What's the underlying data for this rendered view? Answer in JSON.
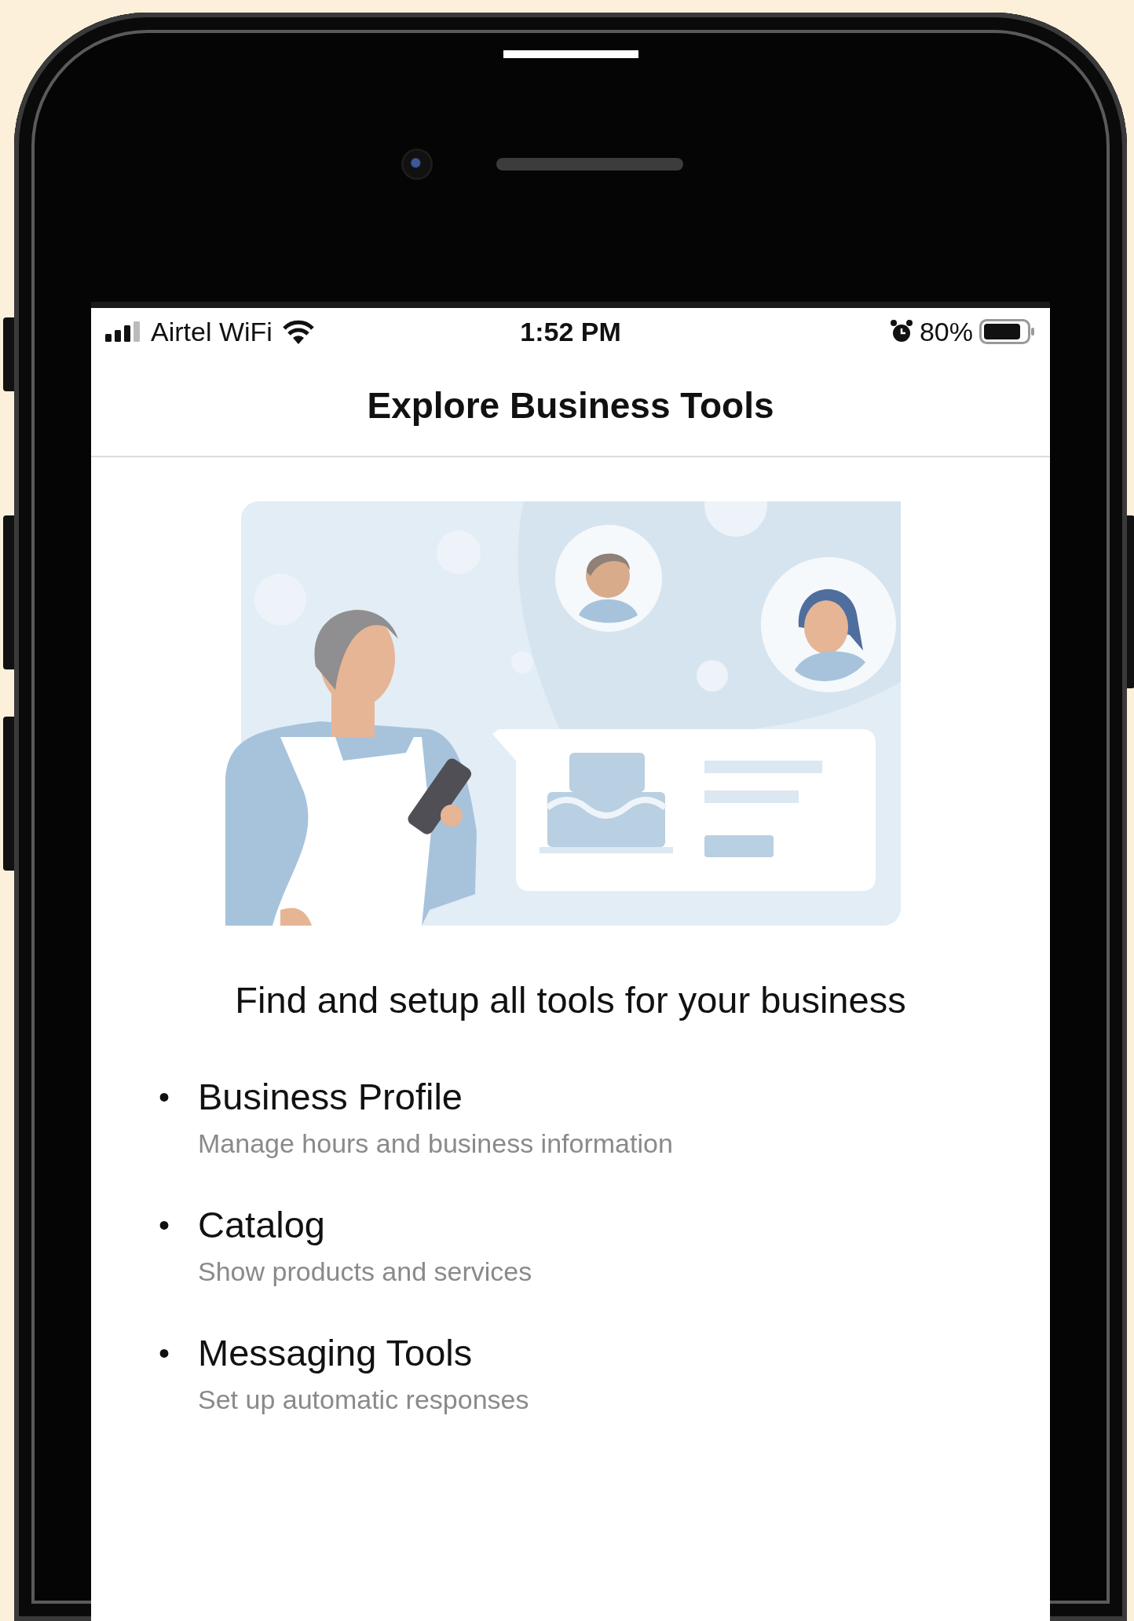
{
  "status_bar": {
    "carrier": "Airtel WiFi",
    "time": "1:52 PM",
    "battery": "80%"
  },
  "header": {
    "title": "Explore Business Tools"
  },
  "intro": "Find and setup all tools for your business",
  "features": [
    {
      "bullet": "•",
      "title": "Business Profile",
      "description": "Manage hours and business information"
    },
    {
      "bullet": "•",
      "title": "Catalog",
      "description": "Show products and services"
    },
    {
      "bullet": "•",
      "title": "Messaging Tools",
      "description": "Set up automatic responses"
    }
  ]
}
